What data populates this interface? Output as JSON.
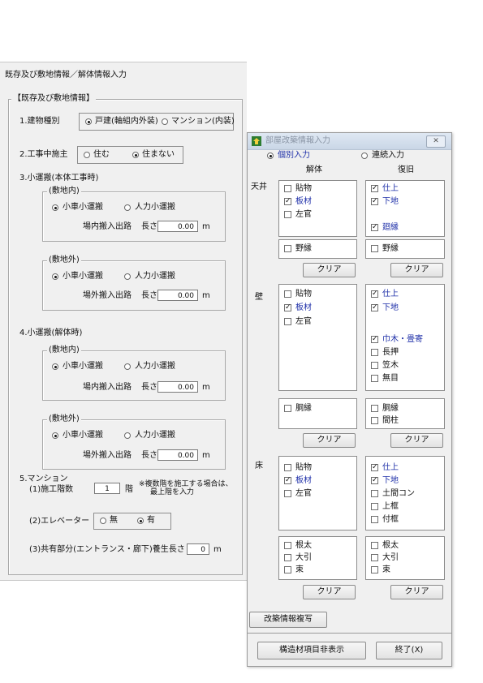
{
  "main": {
    "title": "既存及び敷地情報／解体情報入力",
    "group_label": "【既存及び敷地情報】",
    "q1": {
      "label": "1.建物種別",
      "opt1": "戸建(軸組内外装)",
      "opt2": "マンション(内装)"
    },
    "q2": {
      "label": "2.工事中施主",
      "opt1": "住む",
      "opt2": "住まない"
    },
    "q3": {
      "label": "3.小運搬(本体工事時)"
    },
    "q4": {
      "label": "4.小運搬(解体時)"
    },
    "sub_in": "(敷地内)",
    "sub_out": "(敷地外)",
    "opt_cart": "小車小運搬",
    "opt_manual": "人力小運搬",
    "in_path": "場内搬入出路",
    "out_path": "場外搬入出路",
    "length": "長さ",
    "length_value": "0.00",
    "unit_m": "m",
    "q5": {
      "label": "5.マンション",
      "floors_label": "(1)施工階数",
      "floors_value": "1",
      "floors_unit": "階",
      "note1": "※複数階を施工する場合は、",
      "note2": "最上階を入力",
      "elev_label": "(2)エレベーター",
      "elev_opt1": "無",
      "elev_opt2": "有",
      "common_label": "(3)共有部分(エントランス・廊下)養生長さ",
      "common_value": "0",
      "common_unit": "m"
    }
  },
  "dialog": {
    "title": "部屋改築情報入力",
    "close_glyph": "✕",
    "mode_individual": "個別入力",
    "mode_continuous": "連続入力",
    "col_demolition": "解体",
    "col_restoration": "復旧",
    "ceiling": "天井",
    "wall": "壁",
    "floor": "床",
    "clear": "クリア",
    "ceiling_demo": [
      {
        "label": "貼物",
        "checked": false
      },
      {
        "label": "板材",
        "checked": true
      },
      {
        "label": "左官",
        "checked": false
      }
    ],
    "ceiling_restore": [
      {
        "label": "仕上",
        "checked": true
      },
      {
        "label": "下地",
        "checked": true
      },
      {
        "label": "廻縁",
        "checked": true
      }
    ],
    "ceiling_demo_extra": {
      "label": "野縁",
      "checked": false
    },
    "ceiling_restore_extra": {
      "label": "野縁",
      "checked": false
    },
    "wall_demo": [
      {
        "label": "貼物",
        "checked": false
      },
      {
        "label": "板材",
        "checked": true
      },
      {
        "label": "左官",
        "checked": false
      }
    ],
    "wall_restore": [
      {
        "label": "仕上",
        "checked": true
      },
      {
        "label": "下地",
        "checked": true
      },
      {
        "label": "巾木・畳寄",
        "checked": true
      },
      {
        "label": "長押",
        "checked": false
      },
      {
        "label": "笠木",
        "checked": false
      },
      {
        "label": "無目",
        "checked": false
      }
    ],
    "wall_demo_extra": {
      "label": "胴縁",
      "checked": false
    },
    "wall_restore_extra": [
      {
        "label": "胴縁",
        "checked": false
      },
      {
        "label": "間柱",
        "checked": false
      }
    ],
    "floor_demo": [
      {
        "label": "貼物",
        "checked": false
      },
      {
        "label": "板材",
        "checked": true
      },
      {
        "label": "左官",
        "checked": false
      }
    ],
    "floor_restore": [
      {
        "label": "仕上",
        "checked": true
      },
      {
        "label": "下地",
        "checked": true
      },
      {
        "label": "土間コン",
        "checked": false
      },
      {
        "label": "上框",
        "checked": false
      },
      {
        "label": "付框",
        "checked": false
      }
    ],
    "floor_demo_extra": [
      {
        "label": "根太",
        "checked": false
      },
      {
        "label": "大引",
        "checked": false
      },
      {
        "label": "束",
        "checked": false
      }
    ],
    "floor_restore_extra": [
      {
        "label": "根太",
        "checked": false
      },
      {
        "label": "大引",
        "checked": false
      },
      {
        "label": "束",
        "checked": false
      }
    ],
    "copy_button": "改築情報複写",
    "hide_button": "構造材項目非表示",
    "exit_button": "終了(X)"
  }
}
